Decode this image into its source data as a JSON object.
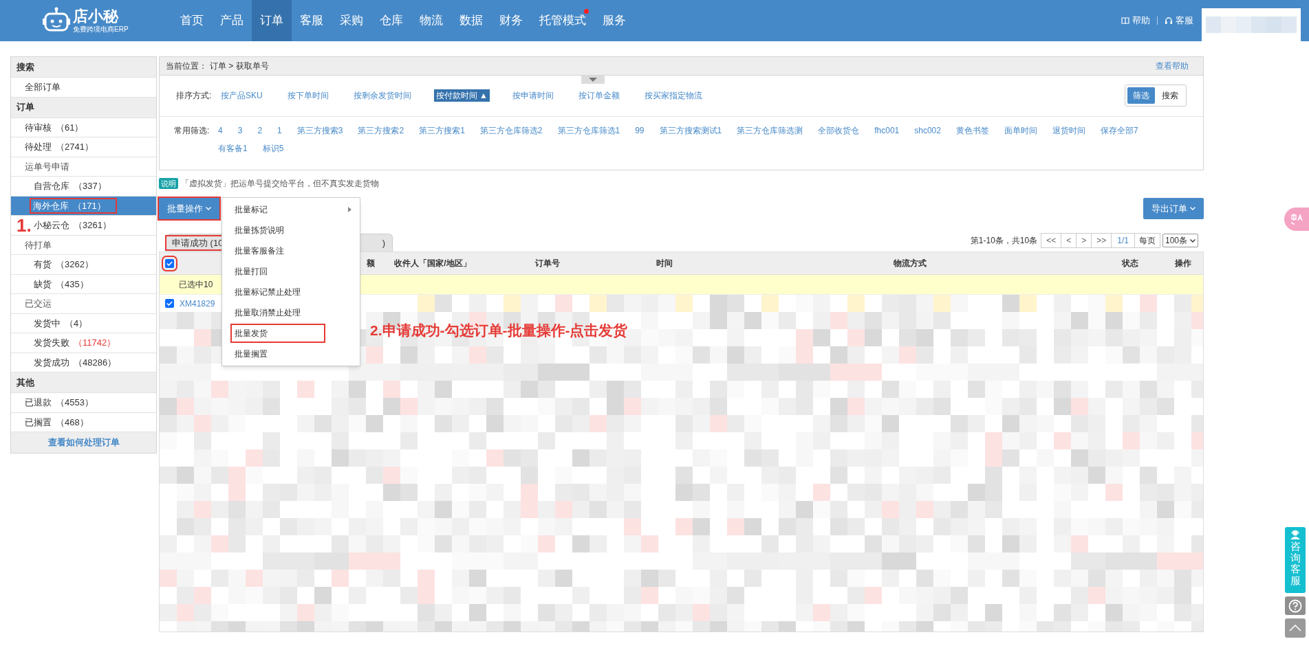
{
  "header": {
    "logo": "店小秘",
    "logo_tagline": "免费跨境电商ERP",
    "nav": [
      {
        "label": "首页",
        "selected": false,
        "dot": false
      },
      {
        "label": "产品",
        "selected": false,
        "dot": false
      },
      {
        "label": "订单",
        "selected": true,
        "dot": false
      },
      {
        "label": "客服",
        "selected": false,
        "dot": false
      },
      {
        "label": "采购",
        "selected": false,
        "dot": false
      },
      {
        "label": "仓库",
        "selected": false,
        "dot": false
      },
      {
        "label": "物流",
        "selected": false,
        "dot": false
      },
      {
        "label": "数据",
        "selected": false,
        "dot": false
      },
      {
        "label": "财务",
        "selected": false,
        "dot": false
      },
      {
        "label": "托管模式",
        "selected": false,
        "dot": true
      },
      {
        "label": "服务",
        "selected": false,
        "dot": false
      }
    ],
    "help": "帮助",
    "service": "客服"
  },
  "sidebar": {
    "sections": [
      {
        "title": "搜索",
        "items": [
          {
            "label": "全部订单",
            "selected": false,
            "highlighted": false
          }
        ]
      },
      {
        "title": "订单",
        "items": [
          {
            "label": "待审核",
            "count": "（61）",
            "selected": false,
            "highlighted": false
          },
          {
            "label": "待处理",
            "count": "（2741）",
            "selected": false,
            "highlighted": false
          },
          {
            "label": "运单号申请",
            "selected": false,
            "highlighted": false,
            "children": [
              {
                "label": "自营仓库",
                "count": "（337）",
                "selected": false,
                "highlighted": false
              },
              {
                "label": "海外仓库",
                "count": "（171）",
                "selected": true,
                "highlighted": true
              },
              {
                "label": "小秘云仓",
                "count": "（3261）",
                "selected": false,
                "highlighted": false
              }
            ]
          },
          {
            "label": "待打单",
            "selected": false,
            "highlighted": false,
            "children": [
              {
                "label": "有货",
                "count": "（3262）",
                "selected": false,
                "highlighted": false
              },
              {
                "label": "缺货",
                "count": "（435）",
                "selected": false,
                "highlighted": false
              }
            ]
          },
          {
            "label": "已交运",
            "selected": false,
            "highlighted": false,
            "children": [
              {
                "label": "发货中",
                "count": "（4）",
                "selected": false,
                "highlighted": false
              },
              {
                "label": "发货失败",
                "count": "（11742）",
                "alert": true,
                "selected": false,
                "highlighted": false
              },
              {
                "label": "发货成功",
                "count": "（48286）",
                "selected": false,
                "highlighted": false
              }
            ]
          }
        ]
      },
      {
        "title": "其他",
        "items": [
          {
            "label": "已退款",
            "count": "（4553）",
            "selected": false,
            "highlighted": false
          },
          {
            "label": "已搁置",
            "count": "（468）",
            "selected": false,
            "highlighted": false
          }
        ]
      }
    ],
    "footer_link": "查看如何处理订单"
  },
  "breadcrumb": {
    "label": "当前位置：",
    "path": "订单 > 获取单号",
    "help_link": "查看帮助"
  },
  "sort": {
    "label": "排序方式:",
    "options": [
      {
        "label": "按产品SKU",
        "selected": false
      },
      {
        "label": "按下单时间",
        "selected": false
      },
      {
        "label": "按剩余发货时间",
        "selected": false
      },
      {
        "label": "按付款时间 ▲",
        "selected": true
      },
      {
        "label": "按申请时间",
        "selected": false
      },
      {
        "label": "按订单金额",
        "selected": false
      },
      {
        "label": "按买家指定物流",
        "selected": false
      }
    ]
  },
  "mode_toggle": [
    {
      "label": "筛选",
      "selected": true
    },
    {
      "label": "搜索",
      "selected": false
    }
  ],
  "filters": {
    "label": "常用筛选:",
    "items": [
      "4",
      "3",
      "2",
      "1",
      "第三方搜索3",
      "第三方搜索2",
      "第三方搜索1",
      "第三方仓库筛选2",
      "第三方仓库筛选1",
      "99",
      "第三方搜索测试1",
      "第三方仓库筛选测",
      "全部收货仓",
      "fhc001",
      "shc002",
      "黄色书签",
      "面单时间",
      "退货时间",
      "保存全部7",
      "有客备1",
      "标识5"
    ]
  },
  "notice": {
    "badge": "说明",
    "text": "「虚拟发货」把运单号提交给平台，但不真实发走货物"
  },
  "batch_button": {
    "label": "批量操作",
    "highlighted": true
  },
  "export_button": "导出订单",
  "batch_menu": [
    {
      "label": "批量标记",
      "submenu": true,
      "highlighted": false
    },
    {
      "label": "批量拣货说明",
      "submenu": false,
      "highlighted": false
    },
    {
      "label": "批量客服备注",
      "submenu": false,
      "highlighted": false
    },
    {
      "label": "批量打回",
      "submenu": false,
      "highlighted": false
    },
    {
      "label": "批量标记禁止处理",
      "submenu": false,
      "highlighted": false
    },
    {
      "label": "批量取消禁止处理",
      "submenu": false,
      "highlighted": false
    },
    {
      "label": "批量发货",
      "submenu": false,
      "highlighted": true
    },
    {
      "label": "批量搁置",
      "submenu": false,
      "highlighted": false
    }
  ],
  "tab": {
    "label_start": "申请成功 (10",
    "label_end": ")",
    "highlighted": true
  },
  "pagination": {
    "summary": "第1-10条，共10条",
    "first": "<<",
    "prev": "<",
    "next": ">",
    "last": ">>",
    "page": "1/1",
    "per_page_label": "每页",
    "per_page": "100条"
  },
  "table": {
    "select_all": {
      "checked": true,
      "highlighted": true
    },
    "columns": [
      {
        "label": "额"
      },
      {
        "label": "收件人「国家/地区」"
      },
      {
        "label": "订单号"
      },
      {
        "label": "时间"
      },
      {
        "label": "物流方式"
      },
      {
        "label": "状态"
      },
      {
        "label": "操作"
      }
    ],
    "selection_bar": "已选中10",
    "rows": [
      {
        "checked": true,
        "order": "XM41829"
      }
    ]
  },
  "annotations": [
    {
      "text": "1."
    },
    {
      "text": "2.申请成功-勾选订单-批量操作-点击发货"
    }
  ],
  "float_buttons": {
    "consult": "咨询客服"
  }
}
